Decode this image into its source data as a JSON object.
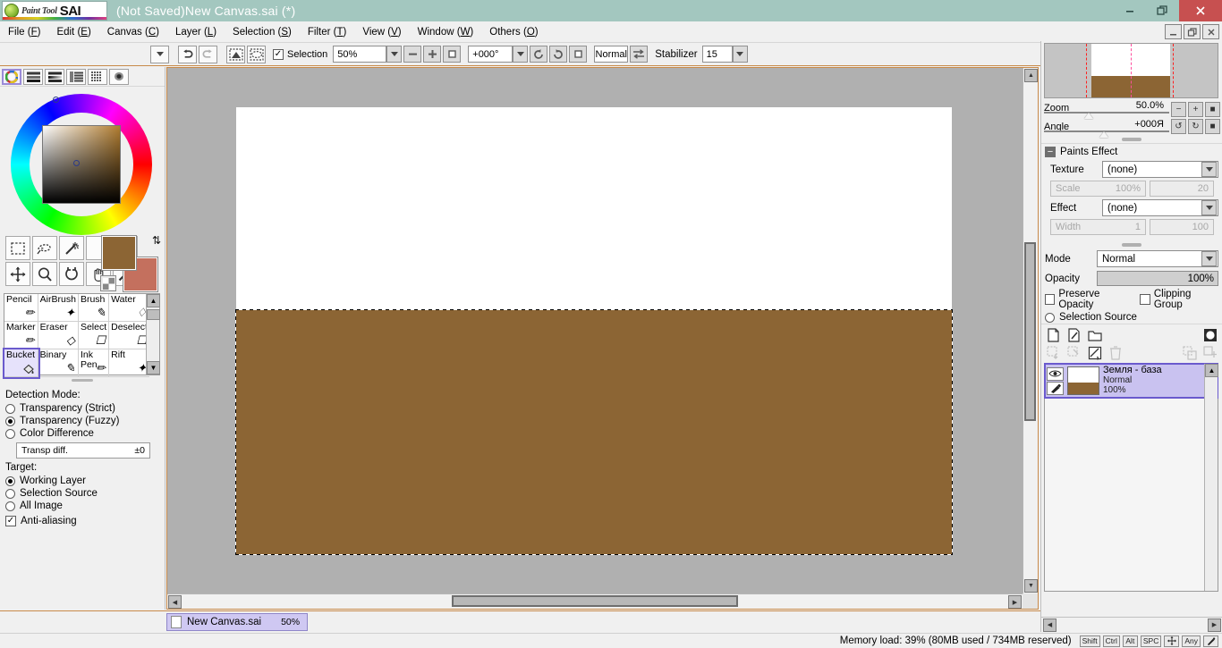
{
  "window": {
    "app_name": "PaintTool SAI",
    "logo_paint": "Paint Tool",
    "logo_sai": "SAI",
    "title": "(Not Saved)New Canvas.sai (*)",
    "minimize": "–",
    "maximize": "❐",
    "close": "✕"
  },
  "menu": {
    "items": [
      {
        "label": "File",
        "key": "F"
      },
      {
        "label": "Edit",
        "key": "E"
      },
      {
        "label": "Canvas",
        "key": "C"
      },
      {
        "label": "Layer",
        "key": "L"
      },
      {
        "label": "Selection",
        "key": "S"
      },
      {
        "label": "Filter",
        "key": "T"
      },
      {
        "label": "View",
        "key": "V"
      },
      {
        "label": "Window",
        "key": "W"
      },
      {
        "label": "Others",
        "key": "O"
      }
    ],
    "mdi_buttons": [
      "minimize-icon",
      "restore-icon",
      "close-icon"
    ]
  },
  "toolbar": {
    "undo_icon": "undo-icon",
    "redo_icon": "redo-icon",
    "sel_invert_icon": "selection-invert-icon",
    "sel_deselect_icon": "selection-deselect-icon",
    "selection_checkbox_label": "Selection",
    "selection_checked": true,
    "zoom_value": "50%",
    "zoom_out_icon": "zoom-out-icon",
    "zoom_in_icon": "zoom-in-icon",
    "zoom_reset_icon": "zoom-reset-icon",
    "angle_value": "+000°",
    "rotate_ccw_icon": "rotate-ccw-icon",
    "rotate_cw_icon": "rotate-cw-icon",
    "rotate_reset_icon": "rotate-reset-icon",
    "view_mode": "Normal",
    "flip_icon": "flip-horizontal-icon",
    "stabilizer_label": "Stabilizer",
    "stabilizer_value": "15"
  },
  "left_panel": {
    "swatch_modes": [
      {
        "name": "color-wheel-mode",
        "active": true
      },
      {
        "name": "rgb-sliders-mode",
        "active": false
      },
      {
        "name": "hsv-sliders-mode",
        "active": false
      },
      {
        "name": "palette-mode",
        "active": false
      },
      {
        "name": "swatch-grid-mode",
        "active": false
      },
      {
        "name": "scratchpad-mode",
        "active": false
      }
    ],
    "colors": {
      "primary": "#8c6534",
      "secondary": "#c4705e"
    },
    "top_tools": [
      {
        "name": "rect-select-tool",
        "glyph": "rect-marquee-icon"
      },
      {
        "name": "lasso-select-tool",
        "glyph": "lasso-icon"
      },
      {
        "name": "magic-wand-tool",
        "glyph": "magic-wand-icon"
      },
      {
        "name": "blank-tool-slot-1",
        "glyph": ""
      },
      {
        "name": "blank-tool-slot-2",
        "glyph": ""
      },
      {
        "name": "move-tool",
        "glyph": "move-icon"
      },
      {
        "name": "zoom-tool",
        "glyph": "magnifier-icon"
      },
      {
        "name": "rotate-tool",
        "glyph": "rotate-icon"
      },
      {
        "name": "hand-tool",
        "glyph": "hand-icon"
      },
      {
        "name": "eyedropper-tool",
        "glyph": "eyedropper-icon"
      }
    ],
    "brushes": [
      {
        "label": "Pencil",
        "icon": "pencil-icon",
        "selected": false
      },
      {
        "label": "AirBrush",
        "icon": "airbrush-icon",
        "selected": false
      },
      {
        "label": "Brush",
        "icon": "brush-icon",
        "selected": false
      },
      {
        "label": "Water",
        "icon": "water-icon",
        "selected": false
      },
      {
        "label": "Marker",
        "icon": "marker-icon",
        "selected": false
      },
      {
        "label": "Eraser",
        "icon": "eraser-icon",
        "selected": false
      },
      {
        "label": "Select",
        "icon": "select-icon",
        "selected": false
      },
      {
        "label": "Deselect",
        "icon": "deselect-icon",
        "selected": false
      },
      {
        "label": "Bucket",
        "icon": "bucket-icon",
        "selected": true
      },
      {
        "label": "Binary",
        "icon": "binary-pen-icon",
        "selected": false
      },
      {
        "label": "Ink Pen",
        "icon": "ink-pen-icon",
        "selected": false
      },
      {
        "label": "Rift",
        "icon": "rift-icon",
        "selected": false
      }
    ],
    "detection_mode_label": "Detection Mode:",
    "detection_modes": [
      {
        "label": "Transparency (Strict)",
        "selected": false
      },
      {
        "label": "Transparency (Fuzzy)",
        "selected": true
      },
      {
        "label": "Color Difference",
        "selected": false
      }
    ],
    "transp_diff_label": "Transp diff.",
    "transp_diff_value": "±0",
    "target_label": "Target:",
    "targets": [
      {
        "label": "Working Layer",
        "selected": true
      },
      {
        "label": "Selection Source",
        "selected": false
      },
      {
        "label": "All Image",
        "selected": false
      }
    ],
    "anti_aliasing_label": "Anti-aliasing",
    "anti_aliasing_checked": true
  },
  "canvas": {
    "paper_color": "#ffffff",
    "fill_color": "#8c6534",
    "background_color": "#b0b0b0",
    "scroll_up_icon": "scroll-up-icon",
    "scroll_down_icon": "scroll-down-icon",
    "scroll_left_icon": "scroll-left-icon",
    "scroll_right_icon": "scroll-right-icon"
  },
  "right_panel": {
    "navigator": {
      "fill_color": "#8c6534",
      "guide_color": "#ff2020"
    },
    "zoom_label": "Zoom",
    "zoom_value": "50.0%",
    "angle_label": "Angle",
    "angle_value": "+000Я",
    "nav_buttons": [
      {
        "name": "zoom-out-button",
        "glyph": "−"
      },
      {
        "name": "zoom-in-button",
        "glyph": "+"
      },
      {
        "name": "zoom-reset-button",
        "glyph": "■"
      },
      {
        "name": "rotate-ccw-button",
        "glyph": "↺"
      },
      {
        "name": "rotate-cw-button",
        "glyph": "↻"
      },
      {
        "name": "rotate-reset-button",
        "glyph": "■"
      }
    ],
    "paints_effect": {
      "title": "Paints Effect",
      "texture_label": "Texture",
      "texture_value": "(none)",
      "scale_label": "Scale",
      "scale_value": "100%",
      "scale_amount": "20",
      "effect_label": "Effect",
      "effect_value": "(none)",
      "width_label": "Width",
      "width_value": "1",
      "width_amount": "100"
    },
    "mode_label": "Mode",
    "mode_value": "Normal",
    "opacity_label": "Opacity",
    "opacity_value": "100%",
    "preserve_opacity_label": "Preserve Opacity",
    "preserve_opacity_checked": false,
    "clipping_group_label": "Clipping Group",
    "clipping_group_checked": false,
    "selection_source_label": "Selection Source",
    "selection_source_checked": false,
    "layer_tools": [
      {
        "name": "new-layer-button",
        "enabled": true
      },
      {
        "name": "new-linework-layer-button",
        "enabled": true
      },
      {
        "name": "new-folder-button",
        "enabled": true
      },
      {
        "name": "layer-mask-button",
        "enabled": true
      },
      {
        "name": "merge-down-button",
        "enabled": false
      },
      {
        "name": "merge-visible-button",
        "enabled": false
      },
      {
        "name": "clear-layer-button",
        "enabled": true
      },
      {
        "name": "delete-layer-button",
        "enabled": false
      },
      {
        "name": "transfer-button",
        "enabled": false
      },
      {
        "name": "duplicate-button",
        "enabled": false
      }
    ],
    "layers": [
      {
        "name": "Земля - база",
        "mode": "Normal",
        "opacity": "100%",
        "visible": true,
        "selected": true,
        "thumb_fill": "#8c6534"
      }
    ]
  },
  "tabbar": {
    "tabs": [
      {
        "label": "New Canvas.sai",
        "zoom": "50%",
        "active": true
      }
    ]
  },
  "statusbar": {
    "memory": "Memory load: 39% (80MB used / 734MB reserved)",
    "keys": [
      "Shift",
      "Ctrl",
      "Alt",
      "SPC",
      "move-key-icon",
      "Any",
      "pen-key-icon"
    ]
  }
}
